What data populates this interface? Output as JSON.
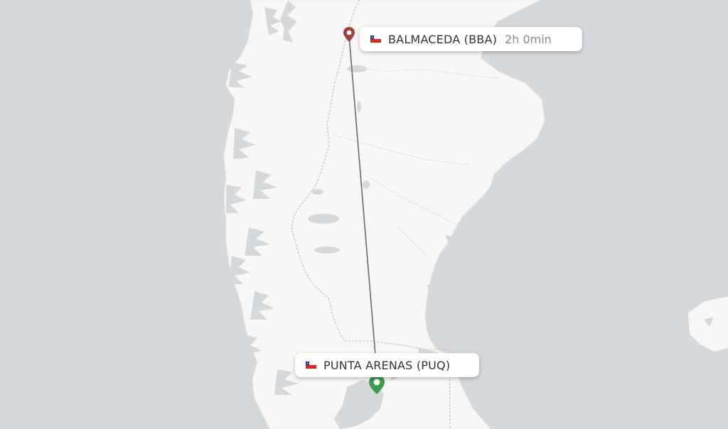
{
  "map": {
    "origin": {
      "label": "BALMACEDA (BBA)",
      "duration": "2h 0min",
      "country_flag": "chile-flag-icon",
      "pin_color": "#a0403c"
    },
    "destination": {
      "label": "PUNTA ARENAS (PUQ)",
      "country_flag": "chile-flag-icon",
      "pin_color": "#3f9a4e"
    },
    "colors": {
      "water": "#d5d9dc",
      "land": "#f7f7f7",
      "border": "#e0b9b9",
      "route": "#6b6b6b"
    }
  }
}
